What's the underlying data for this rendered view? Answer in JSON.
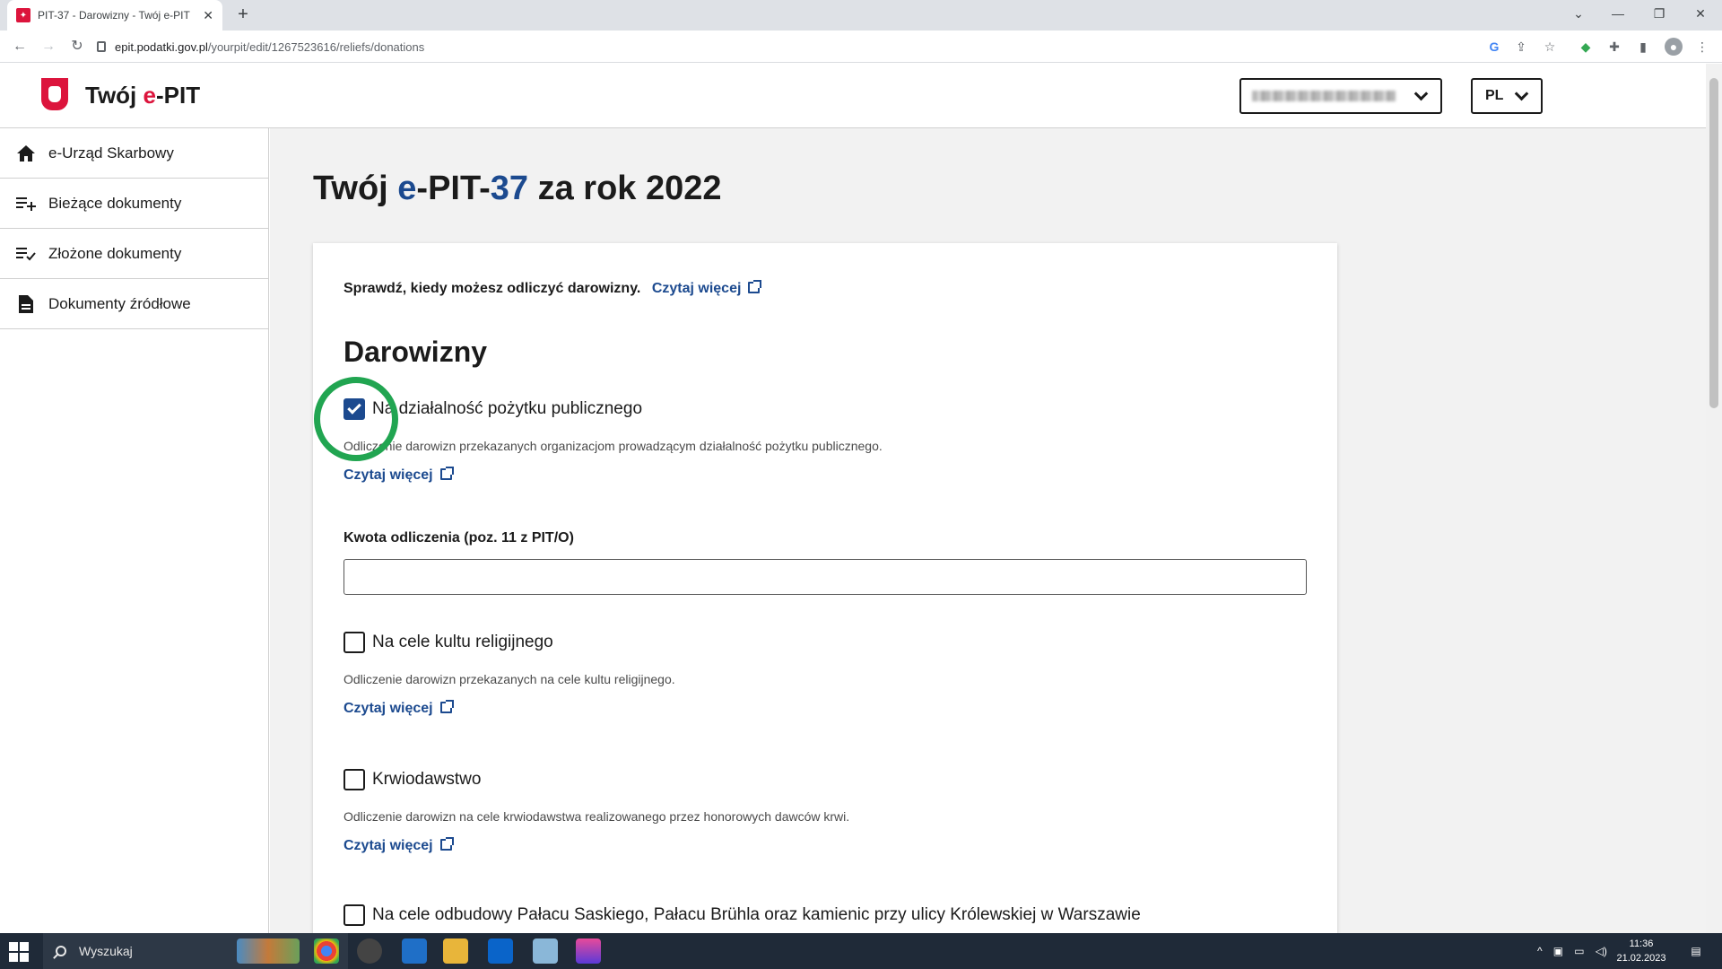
{
  "browser": {
    "tab_title": "PIT-37 - Darowizny - Twój e-PIT",
    "url_host": "epit.podatki.gov.pl",
    "url_path": "/yourpit/edit/1267523616/reliefs/donations",
    "new_tab": "+"
  },
  "header": {
    "logo_part1": "Twój ",
    "logo_accent": "e",
    "logo_part2": "-PIT",
    "language": "PL"
  },
  "sidebar": {
    "items": [
      {
        "label": "e-Urząd Skarbowy",
        "icon": "home-icon"
      },
      {
        "label": "Bieżące dokumenty",
        "icon": "playlist-add-icon"
      },
      {
        "label": "Złożone dokumenty",
        "icon": "playlist-check-icon"
      },
      {
        "label": "Dokumenty źródłowe",
        "icon": "document-icon"
      }
    ]
  },
  "main": {
    "title_part1": "Twój ",
    "title_e": "e",
    "title_part2": "-PIT-",
    "title_num": "37",
    "title_part3": " za rok 2022",
    "intro_text": "Sprawdź, kiedy możesz odliczyć darowizny.",
    "intro_link": "Czytaj więcej",
    "section_title": "Darowizny",
    "options": [
      {
        "label": "Na działalność pożytku publicznego",
        "checked": true,
        "description": "Odliczenie darowizn przekazanych organizacjom prowadzącym działalność pożytku publicznego.",
        "link": "Czytaj więcej"
      },
      {
        "label": "Na cele kultu religijnego",
        "checked": false,
        "description": "Odliczenie darowizn przekazanych na cele kultu religijnego.",
        "link": "Czytaj więcej"
      },
      {
        "label": "Krwiodawstwo",
        "checked": false,
        "description": "Odliczenie darowizn na cele krwiodawstwa realizowanego przez honorowych dawców krwi.",
        "link": "Czytaj więcej"
      },
      {
        "label": "Na cele odbudowy Pałacu Saskiego, Pałacu Brühla oraz kamienic przy ulicy Królewskiej w Warszawie",
        "checked": false
      }
    ],
    "amount_label": "Kwota odliczenia (poz. 11 z PIT/O)",
    "amount_value": ""
  },
  "taskbar": {
    "search_placeholder": "Wyszukaj",
    "time": "11:36",
    "date": "21.02.2023"
  },
  "colors": {
    "brand_red": "#dc143c",
    "link_blue": "#1c4a8f",
    "highlight_green": "#21a551"
  }
}
